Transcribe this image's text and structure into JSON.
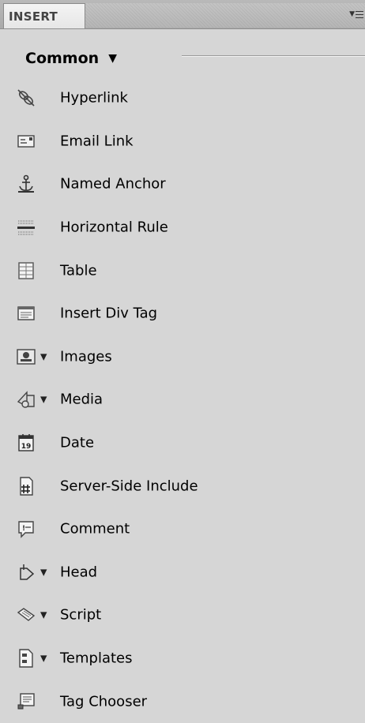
{
  "panel": {
    "tab_label": "INSERT",
    "menu_icon": "panel-options-menu-icon"
  },
  "category": {
    "selected": "Common",
    "caret": "▼"
  },
  "items": [
    {
      "label": "Hyperlink",
      "icon": "hyperlink-icon",
      "has_dropdown": false
    },
    {
      "label": "Email Link",
      "icon": "email-link-icon",
      "has_dropdown": false
    },
    {
      "label": "Named Anchor",
      "icon": "named-anchor-icon",
      "has_dropdown": false
    },
    {
      "label": "Horizontal Rule",
      "icon": "horizontal-rule-icon",
      "has_dropdown": false
    },
    {
      "label": "Table",
      "icon": "table-icon",
      "has_dropdown": false
    },
    {
      "label": "Insert Div Tag",
      "icon": "div-tag-icon",
      "has_dropdown": false
    },
    {
      "label": "Images",
      "icon": "images-icon",
      "has_dropdown": true
    },
    {
      "label": "Media",
      "icon": "media-icon",
      "has_dropdown": true
    },
    {
      "label": "Date",
      "icon": "date-icon",
      "has_dropdown": false,
      "icon_text": "19"
    },
    {
      "label": "Server-Side Include",
      "icon": "server-side-include-icon",
      "has_dropdown": false
    },
    {
      "label": "Comment",
      "icon": "comment-icon",
      "has_dropdown": false
    },
    {
      "label": "Head",
      "icon": "head-icon",
      "has_dropdown": true
    },
    {
      "label": "Script",
      "icon": "script-icon",
      "has_dropdown": true
    },
    {
      "label": "Templates",
      "icon": "templates-icon",
      "has_dropdown": true
    },
    {
      "label": "Tag Chooser",
      "icon": "tag-chooser-icon",
      "has_dropdown": false
    }
  ],
  "dropdown_arrow": "▼"
}
